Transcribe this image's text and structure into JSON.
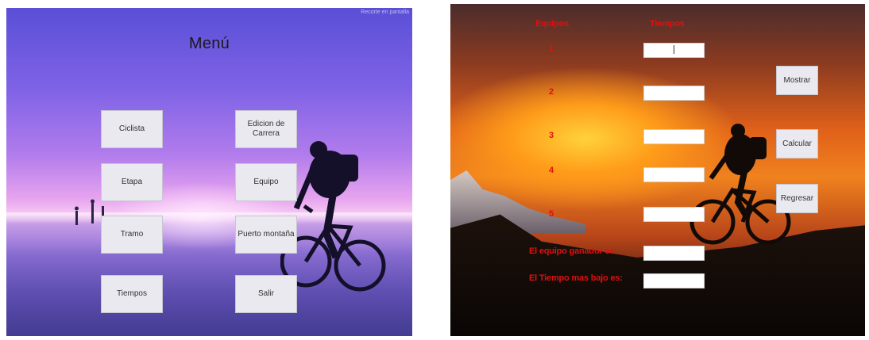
{
  "menu_window": {
    "watermark": "Recorte en pantalla",
    "title": "Menú",
    "buttons": {
      "ciclista": "Ciclista",
      "etapa": "Etapa",
      "tramo": "Tramo",
      "tiempos": "Tiempos",
      "edicion_carrera": "Edicion de Carrera",
      "equipo": "Equipo",
      "puerto_montana": "Puerto montaña",
      "salir": "Salir"
    }
  },
  "times_window": {
    "header_equipos": "Equipos",
    "header_tiempos": "Tiempos",
    "team_numbers": [
      "1",
      "2",
      "3",
      "4",
      "5"
    ],
    "team_time_values": [
      "",
      "",
      "",
      "",
      ""
    ],
    "winner_label": "El equipo ganador es:",
    "winner_value": "",
    "lowest_time_label": "El Tiempo mas bajo es:",
    "lowest_time_value": "",
    "buttons": {
      "mostrar": "Mostrar",
      "calcular": "Calcular",
      "regresar": "Regresar"
    }
  },
  "colors": {
    "label_red": "#e01010",
    "button_face": "#e9e9ef"
  }
}
